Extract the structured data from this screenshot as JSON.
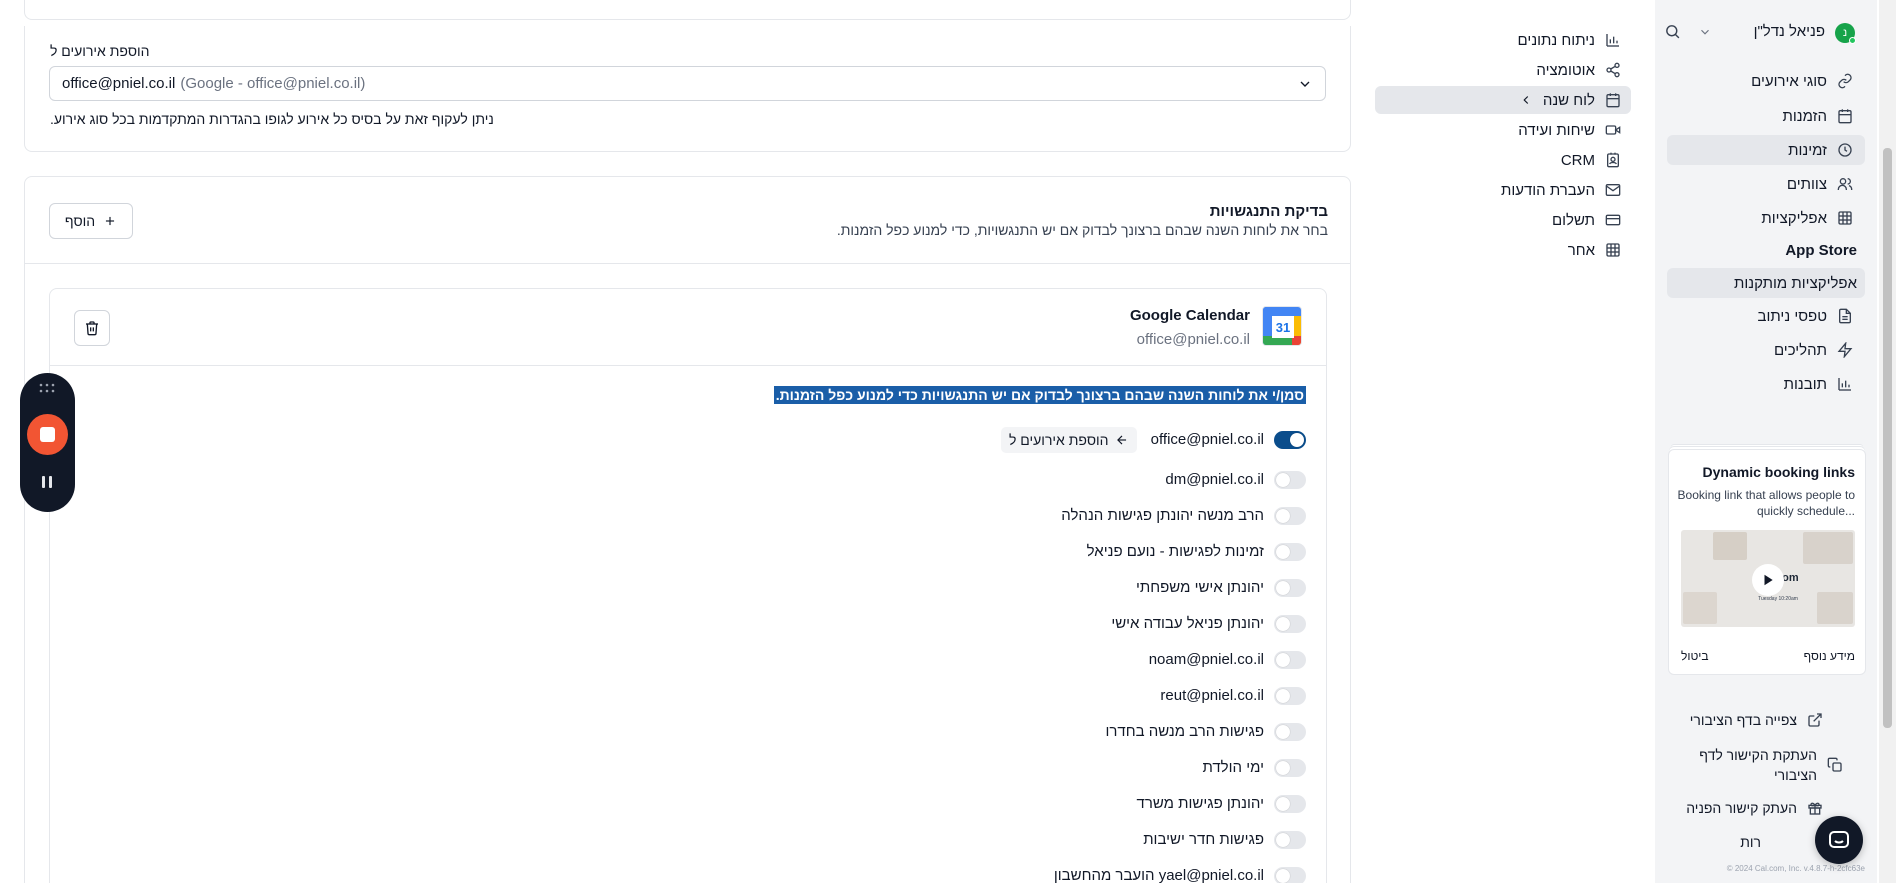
{
  "sidebar": {
    "user_name": "פניאל נדל\"ן",
    "avatar_letter": "נ",
    "items": [
      {
        "label": "סוגי אירועים",
        "icon": "link-icon"
      },
      {
        "label": "הזמנות",
        "icon": "calendar-icon"
      },
      {
        "label": "זמינות",
        "icon": "clock-icon"
      },
      {
        "label": "צוותים",
        "icon": "users-icon"
      },
      {
        "label": "אפליקציות",
        "icon": "grid-icon"
      },
      {
        "label": "App Store",
        "icon": ""
      },
      {
        "label": "אפליקציות מותקנות",
        "icon": ""
      },
      {
        "label": "טפסי ניתוב",
        "icon": "file-text-icon"
      },
      {
        "label": "תהליכים",
        "icon": "zap-icon"
      },
      {
        "label": "תובנות",
        "icon": "bar-chart-icon"
      }
    ],
    "promo": {
      "title": "Dynamic booking links",
      "desc": "Booking link that allows people to quickly schedule...",
      "thumb_text": ".com",
      "thumb_sub": "Tuesday 10:20am",
      "more": "מידע נוסף",
      "dismiss": "ביטול"
    },
    "bottom": [
      {
        "label": "צפייה בדף הציבורי",
        "icon": "external-link-icon"
      },
      {
        "label": "העתקת הקישור לדף הציבורי",
        "icon": "copy-icon"
      },
      {
        "label": "העתק קישור הפניה",
        "icon": "gift-icon"
      },
      {
        "label": "רות",
        "icon": ""
      }
    ],
    "footer": "© 2024 Cal.com, Inc. v.4.8.7-h-2cfc63e"
  },
  "settings_nav": [
    {
      "label": "ניתוח נתונים",
      "icon": "bar-chart-icon"
    },
    {
      "label": "אוטומציה",
      "icon": "share-icon"
    },
    {
      "label": "לוח שנה",
      "icon": "calendar-icon"
    },
    {
      "label": "שיחות ועידה",
      "icon": "video-icon"
    },
    {
      "label": "CRM",
      "icon": "contact-icon"
    },
    {
      "label": "העברת הודעות",
      "icon": "mail-icon"
    },
    {
      "label": "תשלום",
      "icon": "credit-card-icon"
    },
    {
      "label": "אחר",
      "icon": "grid-icon"
    }
  ],
  "add_events": {
    "label": "הוספת אירועים ל",
    "selected_email": "office@pniel.co.il",
    "selected_detail": "(Google - office@pniel.co.il)",
    "hint": "ניתן לעקוף זאת על בסיס כל אירוע לגופו בהגדרות המתקדמות בכל סוג אירוע."
  },
  "conflicts": {
    "title": "בדיקת התנגשויות",
    "desc": "בחר את לוחות השנה שבהם ברצונך לבדוק אם יש התנגשויות, כדי למנוע כפל הזמנות.",
    "add_button": "הוסף"
  },
  "google": {
    "name": "Google Calendar",
    "email": "office@pniel.co.il",
    "icon_num": "31",
    "instruction": "סמן/י את לוחות השנה שבהם ברצונך לבדוק אם יש התנגשויות כדי למנוע כפל הזמנות.",
    "add_events_badge": "הוספת אירועים ל",
    "calendars": [
      {
        "name": "office@pniel.co.il",
        "on": true
      },
      {
        "name": "dm@pniel.co.il",
        "on": false
      },
      {
        "name": "הרב מנשה יהונתן פגישות הנהלה",
        "on": false
      },
      {
        "name": "זמינות לפגישות - נועם פניאל",
        "on": false
      },
      {
        "name": "יהונתן אישי משפחתי",
        "on": false
      },
      {
        "name": "יהונתן פניאל עבודה אישי",
        "on": false
      },
      {
        "name": "noam@pniel.co.il",
        "on": false
      },
      {
        "name": "reut@pniel.co.il",
        "on": false
      },
      {
        "name": "פגישות הרב מנשה בחדרו",
        "on": false
      },
      {
        "name": "ימי הולדת",
        "on": false
      },
      {
        "name": "יהונתן פגישות משרד",
        "on": false
      },
      {
        "name": "פגישות חדר ישיבות",
        "on": false
      },
      {
        "name": "yael@pniel.co.il הועבר מהחשבון",
        "on": false
      }
    ]
  },
  "colors": {
    "accent": "#0a4d8c",
    "record": "#f25533",
    "panel": "#111827",
    "highlight": "#1a5ea8"
  }
}
